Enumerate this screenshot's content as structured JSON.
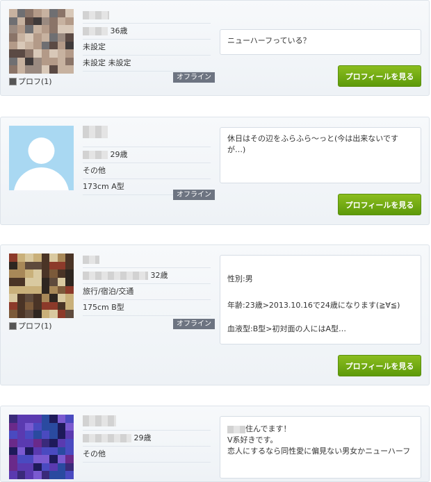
{
  "profiles": [
    {
      "age": "36歳",
      "line2": "未設定",
      "line3": "未設定 未設定",
      "photo_label": "プロフ(1)",
      "status": "オフライン",
      "message": "ニューハーフっている？",
      "button": "プロフィールを見る"
    },
    {
      "age": "29歳",
      "line2": "その他",
      "line3": "173cm A型",
      "status": "オフライン",
      "message": "休日はその辺をふらふら～っと(今は出来ないですが…)",
      "button": "プロフィールを見る"
    },
    {
      "age": "32歳",
      "line2": "旅行/宿泊/交通",
      "line3": "175cm B型",
      "photo_label": "プロフ(1)",
      "status": "オフライン",
      "message_lines": [
        "性別:男",
        "",
        "年齢:23歳>2013.10.16で24歳になります(≧∀≦)",
        "",
        "血液型:B型>初対面の人にはA型…"
      ],
      "button": "プロフィールを見る"
    },
    {
      "age": "29歳",
      "line2": "その他",
      "message_lines": [
        "住んでます！",
        "V系好きです。",
        "恋人にするなら同性愛に偏見ない男女かニューハーフ"
      ]
    }
  ]
}
